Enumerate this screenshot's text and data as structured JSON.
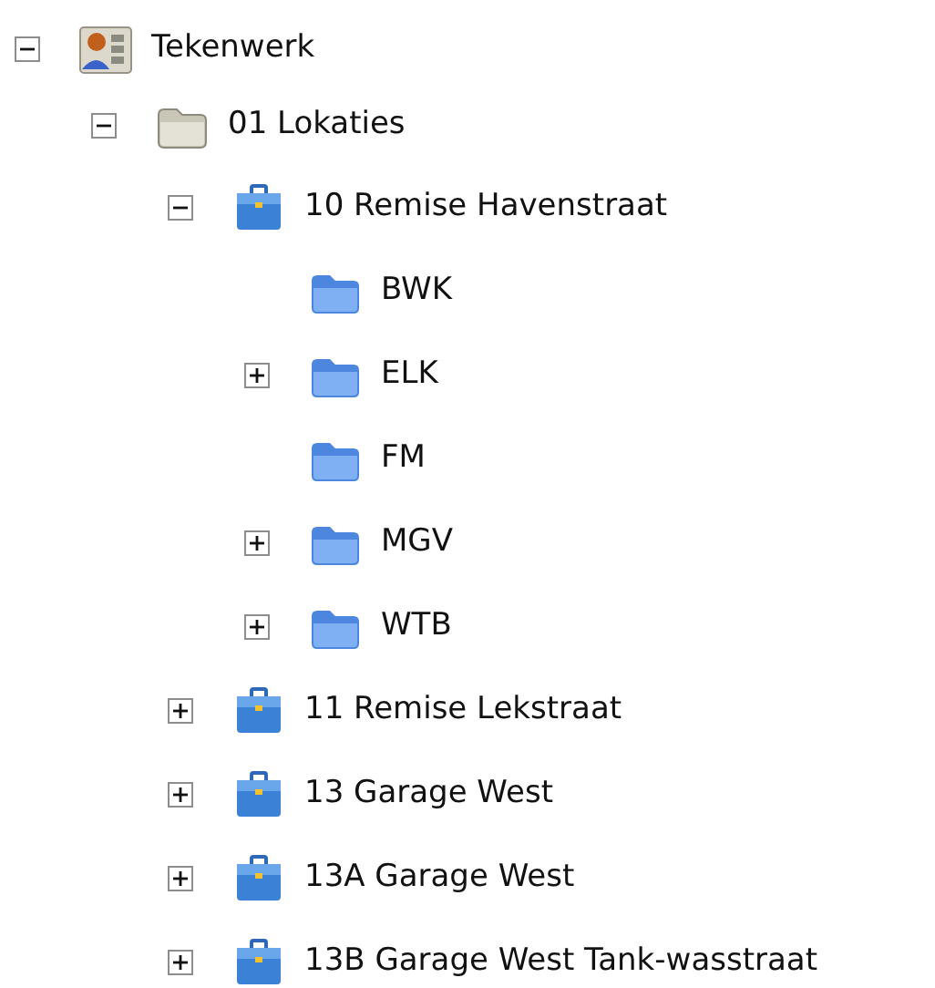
{
  "tree": [
    {
      "label": "Tekenwerk",
      "kind": "root",
      "expandable": true,
      "expanded": true,
      "children": [
        {
          "label": "01 Lokaties",
          "kind": "group",
          "expandable": true,
          "expanded": true,
          "children": [
            {
              "label": "10 Remise Havenstraat",
              "kind": "location",
              "expandable": true,
              "expanded": true,
              "children": [
                {
                  "label": "BWK",
                  "kind": "folder",
                  "expandable": false
                },
                {
                  "label": "ELK",
                  "kind": "folder",
                  "expandable": true,
                  "expanded": false
                },
                {
                  "label": "FM",
                  "kind": "folder",
                  "expandable": false
                },
                {
                  "label": "MGV",
                  "kind": "folder",
                  "expandable": true,
                  "expanded": false
                },
                {
                  "label": "WTB",
                  "kind": "folder",
                  "expandable": true,
                  "expanded": false
                }
              ]
            },
            {
              "label": "11 Remise Lekstraat",
              "kind": "location",
              "expandable": true,
              "expanded": false
            },
            {
              "label": "13 Garage West",
              "kind": "location",
              "expandable": true,
              "expanded": false
            },
            {
              "label": "13A Garage West",
              "kind": "location",
              "expandable": true,
              "expanded": false
            },
            {
              "label": "13B Garage West Tank-wasstraat",
              "kind": "location",
              "expandable": true,
              "expanded": false
            }
          ]
        }
      ]
    }
  ]
}
